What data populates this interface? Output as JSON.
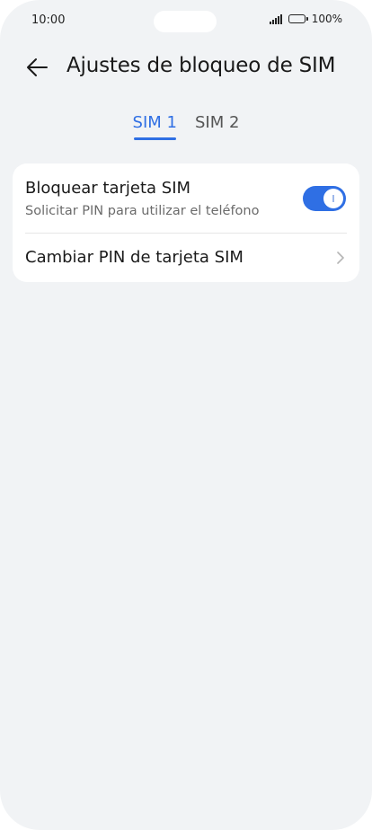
{
  "status_bar": {
    "time": "10:00",
    "battery": "100%"
  },
  "header": {
    "title": "Ajustes de bloqueo de SIM",
    "back_icon": "arrow-left-icon"
  },
  "tabs": [
    {
      "label": "SIM 1",
      "selected": true
    },
    {
      "label": "SIM 2",
      "selected": false
    }
  ],
  "settings": {
    "lock_sim": {
      "title": "Bloquear tarjeta SIM",
      "subtitle": "Solicitar PIN para utilizar el teléfono",
      "enabled": true
    },
    "change_pin": {
      "title": "Cambiar PIN de tarjeta SIM",
      "icon": "chevron-right-icon"
    }
  },
  "colors": {
    "accent": "#2f6fe4",
    "background": "#f1f3f5",
    "card": "#ffffff"
  }
}
